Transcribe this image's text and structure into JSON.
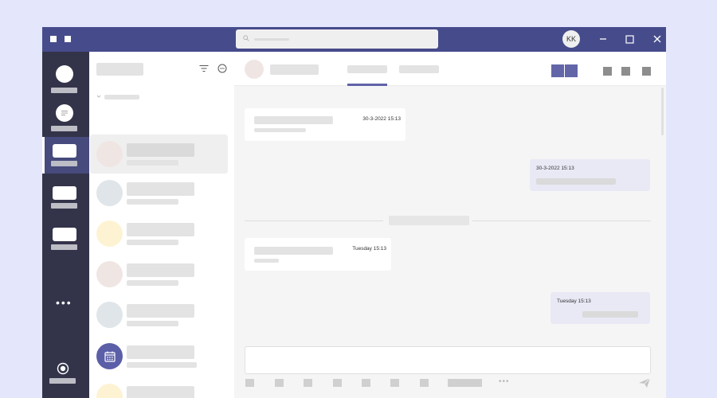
{
  "titlebar": {
    "user_initials": "KK",
    "window_controls": [
      "minimize-icon",
      "maximize-icon",
      "close-icon"
    ],
    "colors": {
      "titlebar": "#464b8c",
      "rail": "#33344a",
      "accent": "#6063a8"
    }
  },
  "rail": {
    "items": [
      {
        "icon": "activity-icon",
        "active": false
      },
      {
        "icon": "chat-icon",
        "active": false
      },
      {
        "icon": "teams-icon",
        "active": true
      },
      {
        "icon": "calendar-icon",
        "active": false
      },
      {
        "icon": "calls-icon",
        "active": false
      }
    ],
    "more_label": "•••",
    "bottom_icon": "apps-icon"
  },
  "chat_list": {
    "items": [
      {
        "avatar_color": "#efe6e4",
        "selected": true
      },
      {
        "avatar_color": "#dfe5e8",
        "selected": false
      },
      {
        "avatar_color": "#fdf3d3",
        "selected": false
      },
      {
        "avatar_color": "#efe6e4",
        "selected": false
      },
      {
        "avatar_color": "#dfe5e8",
        "selected": false
      },
      {
        "avatar_color": "#5b5fa8",
        "selected": false,
        "icon": "calendar-icon"
      },
      {
        "avatar_color": "#fdf3d3",
        "selected": false
      }
    ]
  },
  "conversation": {
    "messages": [
      {
        "direction": "in",
        "timestamp": "30-3-2022  15:13"
      },
      {
        "direction": "out",
        "timestamp": "30-3-2022  15:13"
      },
      {
        "direction": "in",
        "timestamp": "Tuesday 15:13"
      },
      {
        "direction": "out",
        "timestamp": "Tuesday 15:13"
      }
    ]
  },
  "compose": {
    "more_label": "•••"
  }
}
